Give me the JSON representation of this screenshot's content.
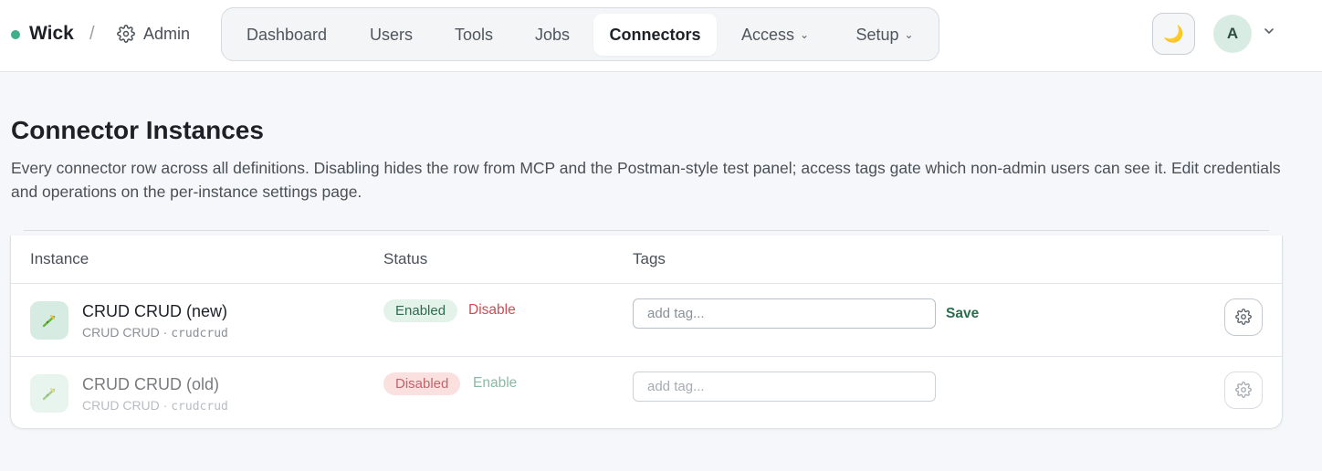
{
  "header": {
    "brand": "Wick",
    "separator": "/",
    "section": "Admin",
    "theme_toggle_icon": "🌙",
    "avatar_initial": "A",
    "accent_color": "#3fae8a"
  },
  "nav": {
    "items": [
      {
        "label": "Dashboard",
        "active": false,
        "dropdown": false
      },
      {
        "label": "Users",
        "active": false,
        "dropdown": false
      },
      {
        "label": "Tools",
        "active": false,
        "dropdown": false
      },
      {
        "label": "Jobs",
        "active": false,
        "dropdown": false
      },
      {
        "label": "Connectors",
        "active": true,
        "dropdown": false
      },
      {
        "label": "Access",
        "active": false,
        "dropdown": true
      },
      {
        "label": "Setup",
        "active": false,
        "dropdown": true
      }
    ]
  },
  "page": {
    "title": "Connector Instances",
    "description": "Every connector row across all definitions. Disabling hides the row from MCP and the Postman-style test panel; access tags gate which non-admin users can see it. Edit credentials and operations on the per-instance settings page."
  },
  "table": {
    "headers": {
      "instance": "Instance",
      "status": "Status",
      "tags": "Tags"
    },
    "rows": [
      {
        "name": "CRUD CRUD (new)",
        "definition": "CRUD CRUD",
        "dot": "·",
        "slug": "crudcrud",
        "status": "Enabled",
        "toggle_action": "Disable",
        "tag_placeholder": "add tag...",
        "tag_value": "",
        "save_label": "Save"
      },
      {
        "name": "CRUD CRUD (old)",
        "definition": "CRUD CRUD",
        "dot": "·",
        "slug": "crudcrud",
        "status": "Disabled",
        "toggle_action": "Enable",
        "tag_placeholder": "add tag...",
        "tag_value": ""
      }
    ]
  }
}
